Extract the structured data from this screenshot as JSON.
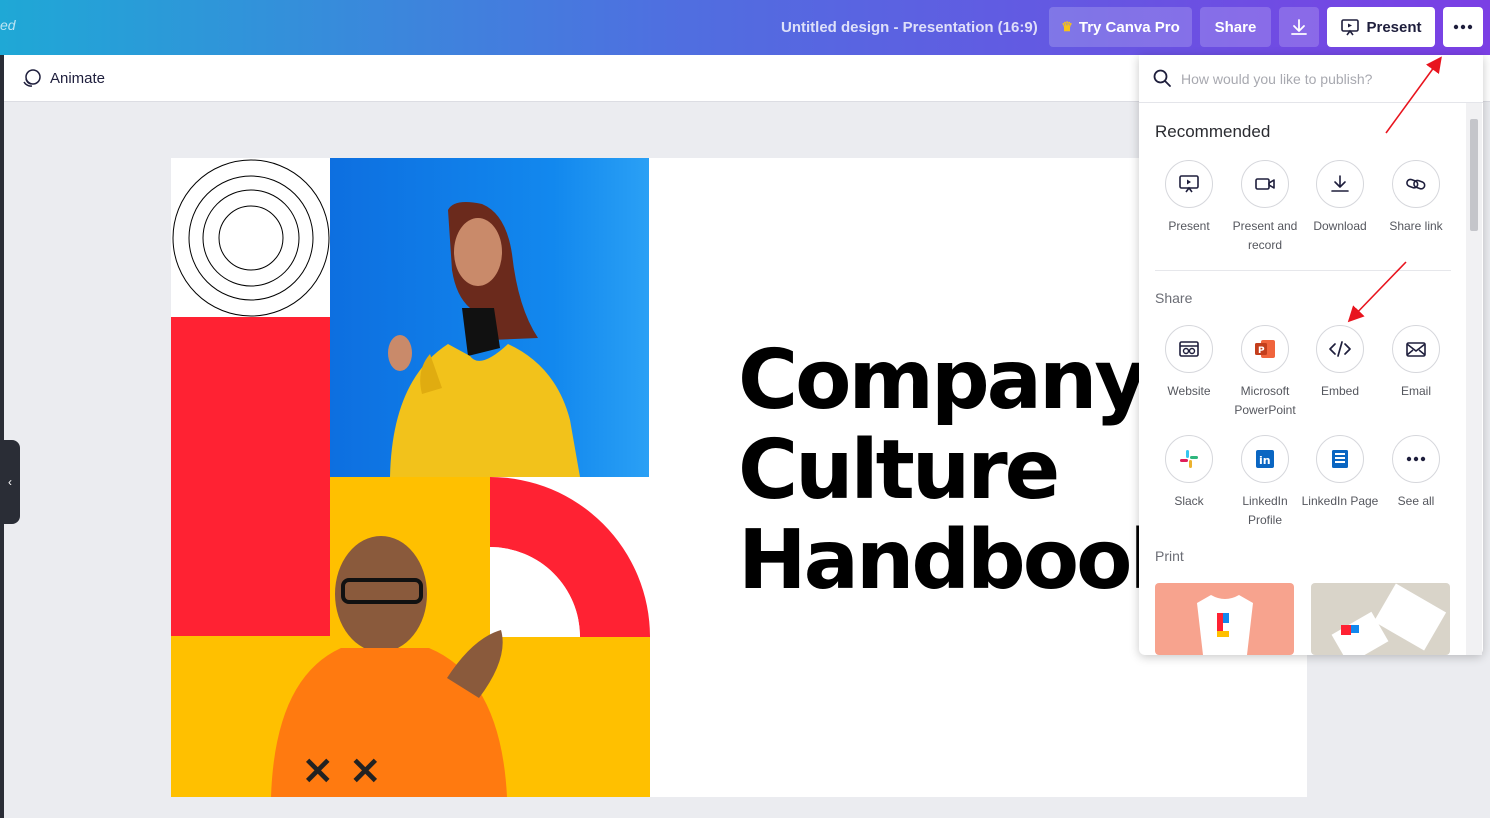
{
  "topbar": {
    "saved_text": "ed",
    "doc_title": "Untitled design - Presentation (16:9)",
    "try_pro_label": "Try Canva Pro",
    "share_label": "Share",
    "present_label": "Present"
  },
  "toolbar": {
    "animate_label": "Animate"
  },
  "slide": {
    "title_lines": [
      "Company",
      "Culture",
      "Handbook"
    ]
  },
  "publish_panel": {
    "search_placeholder": "How would you like to publish?",
    "recommended_title": "Recommended",
    "recommended": [
      {
        "label": "Present",
        "icon": "present-icon"
      },
      {
        "label": "Present and record",
        "icon": "camera-icon"
      },
      {
        "label": "Download",
        "icon": "download-icon"
      },
      {
        "label": "Share link",
        "icon": "link-icon"
      }
    ],
    "share_title": "Share",
    "share": [
      {
        "label": "Website",
        "icon": "website-icon"
      },
      {
        "label": "Microsoft PowerPoint",
        "icon": "powerpoint-icon"
      },
      {
        "label": "Embed",
        "icon": "embed-code-icon"
      },
      {
        "label": "Email",
        "icon": "email-icon"
      },
      {
        "label": "Slack",
        "icon": "slack-icon"
      },
      {
        "label": "LinkedIn Profile",
        "icon": "linkedin-icon"
      },
      {
        "label": "LinkedIn Page",
        "icon": "linkedin-page-icon"
      },
      {
        "label": "See all",
        "icon": "more-dots-icon"
      }
    ],
    "print_title": "Print"
  },
  "colors": {
    "topbar_gradient": [
      "#1fa8d6",
      "#7b3fe4"
    ],
    "slide_red": "#ff2233",
    "slide_yellow": "#ffc000",
    "slide_blue": "#0d6fe0",
    "annotation_arrow": "#e8141e"
  }
}
